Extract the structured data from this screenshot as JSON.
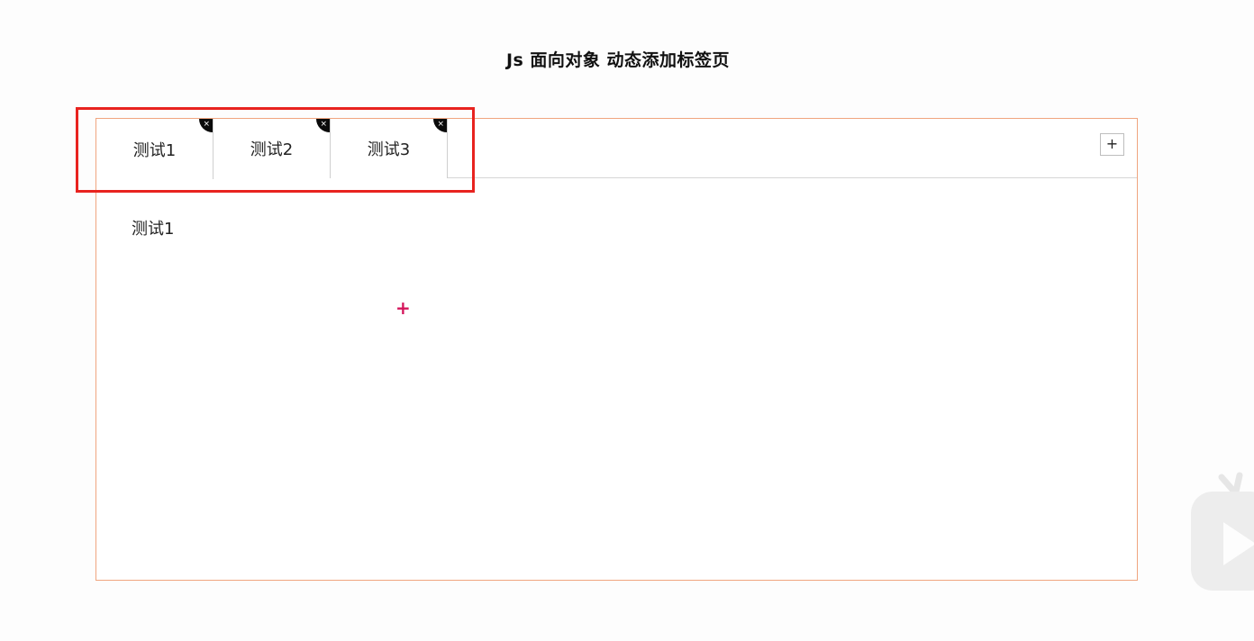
{
  "title": "Js 面向对象 动态添加标签页",
  "tabs": [
    {
      "label": "测试1",
      "close": "×"
    },
    {
      "label": "测试2",
      "close": "×"
    },
    {
      "label": "测试3",
      "close": "×"
    }
  ],
  "add_button": "+",
  "content_text": "测试1",
  "cursor_glyph": "+",
  "icons": {
    "close": "close-icon",
    "add": "plus-icon",
    "watermark": "play-logo-icon"
  },
  "colors": {
    "panel_border": "#f0a57f",
    "highlight": "#e8231f",
    "cursor": "#d4145a"
  }
}
